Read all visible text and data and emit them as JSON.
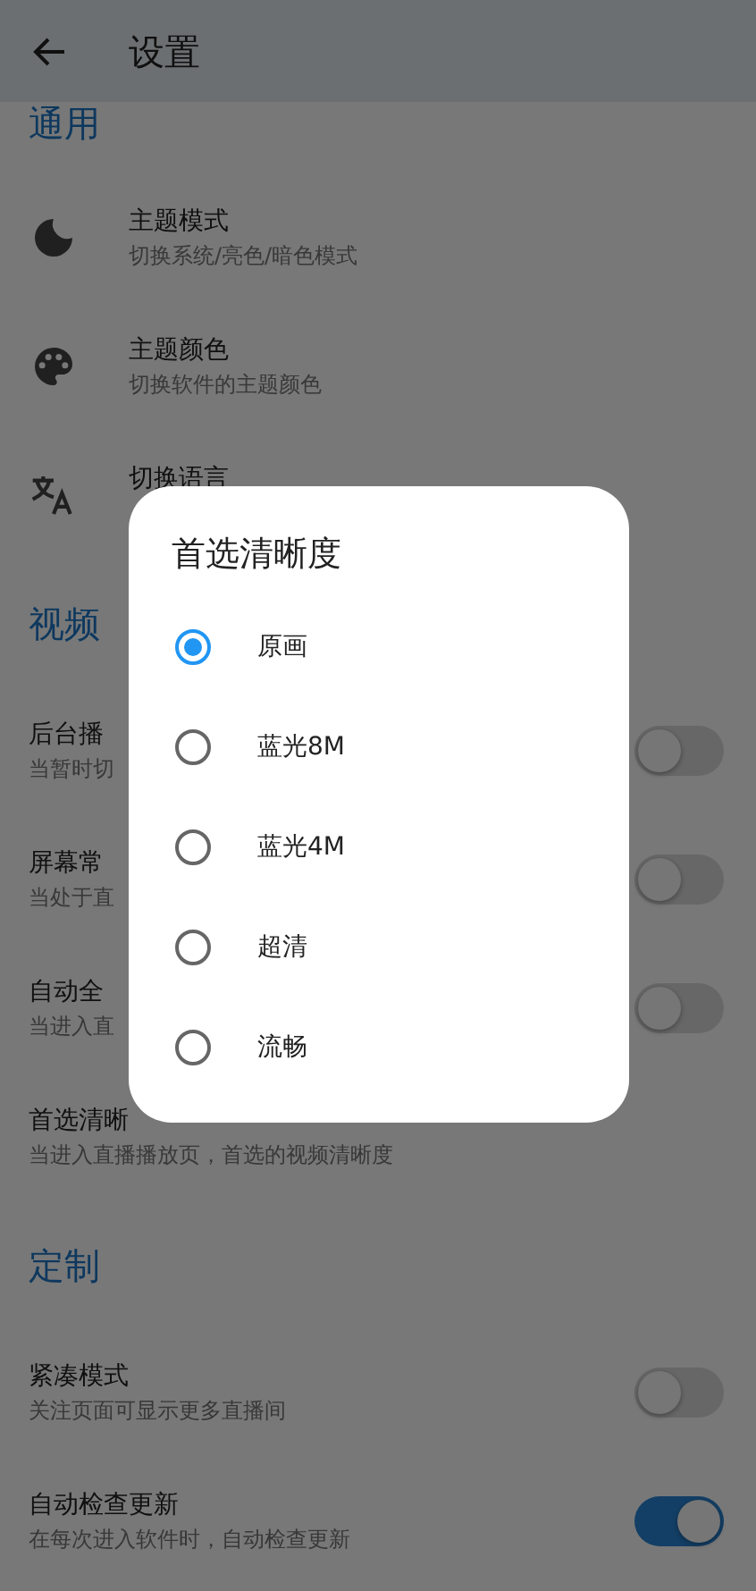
{
  "header": {
    "title": "设置"
  },
  "sections": [
    {
      "title": "通用",
      "items": [
        {
          "kind": "icon",
          "title": "主题模式",
          "subtitle": "切换系统/亮色/暗色模式"
        },
        {
          "kind": "icon",
          "title": "主题颜色",
          "subtitle": "切换软件的主题颜色"
        },
        {
          "kind": "icon",
          "title": "切换语言"
        }
      ]
    },
    {
      "title": "视频",
      "items": [
        {
          "kind": "switch",
          "title": "后台播",
          "subtitle": "当暂时切",
          "on": false
        },
        {
          "kind": "switch",
          "title": "屏幕常",
          "subtitle": "当处于直",
          "on": false
        },
        {
          "kind": "switch",
          "title": "自动全",
          "subtitle": "当进入直",
          "on": false
        },
        {
          "kind": "plain",
          "title": "首选清晰",
          "subtitle": "当进入直播播放页，首选的视频清晰度"
        }
      ]
    },
    {
      "title": "定制",
      "items": [
        {
          "kind": "switch",
          "title": "紧凑模式",
          "subtitle": "关注页面可显示更多直播间",
          "on": false
        },
        {
          "kind": "switch",
          "title": "自动检查更新",
          "subtitle": "在每次进入软件时，自动检查更新",
          "on": true
        }
      ]
    }
  ],
  "dialog": {
    "title": "首选清晰度",
    "options": [
      {
        "label": "原画",
        "selected": true
      },
      {
        "label": "蓝光8M",
        "selected": false
      },
      {
        "label": "蓝光4M",
        "selected": false
      },
      {
        "label": "超清",
        "selected": false
      },
      {
        "label": "流畅",
        "selected": false
      }
    ]
  }
}
